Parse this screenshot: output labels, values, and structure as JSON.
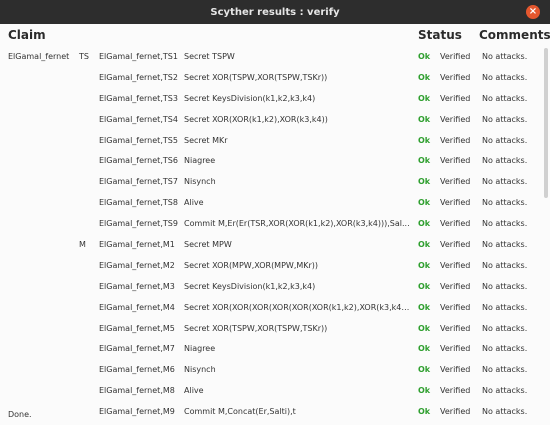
{
  "window": {
    "title": "Scyther results : verify",
    "close_glyph": "×"
  },
  "header": {
    "claim": "Claim",
    "status": "Status",
    "comments": "Comments"
  },
  "rows": [
    {
      "protocol": "ElGamal_fernet",
      "role": "TS",
      "id": "ElGamal_fernet,TS1",
      "claim": "Secret TSPW",
      "status": "Ok",
      "verified": "Verified",
      "comment": "No attacks."
    },
    {
      "protocol": "",
      "role": "",
      "id": "ElGamal_fernet,TS2",
      "claim": "Secret XOR(TSPW,XOR(TSPW,TSKr))",
      "status": "Ok",
      "verified": "Verified",
      "comment": "No attacks."
    },
    {
      "protocol": "",
      "role": "",
      "id": "ElGamal_fernet,TS3",
      "claim": "Secret KeysDivision(k1,k2,k3,k4)",
      "status": "Ok",
      "verified": "Verified",
      "comment": "No attacks."
    },
    {
      "protocol": "",
      "role": "",
      "id": "ElGamal_fernet,TS4",
      "claim": "Secret XOR(XOR(k1,k2),XOR(k3,k4))",
      "status": "Ok",
      "verified": "Verified",
      "comment": "No attacks."
    },
    {
      "protocol": "",
      "role": "",
      "id": "ElGamal_fernet,TS5",
      "claim": "Secret MKr",
      "status": "Ok",
      "verified": "Verified",
      "comment": "No attacks."
    },
    {
      "protocol": "",
      "role": "",
      "id": "ElGamal_fernet,TS6",
      "claim": "Niagree",
      "status": "Ok",
      "verified": "Verified",
      "comment": "No attacks."
    },
    {
      "protocol": "",
      "role": "",
      "id": "ElGamal_fernet,TS7",
      "claim": "Nisynch",
      "status": "Ok",
      "verified": "Verified",
      "comment": "No attacks."
    },
    {
      "protocol": "",
      "role": "",
      "id": "ElGamal_fernet,TS8",
      "claim": "Alive",
      "status": "Ok",
      "verified": "Verified",
      "comment": "No attacks."
    },
    {
      "protocol": "",
      "role": "",
      "id": "ElGamal_fernet,TS9",
      "claim": "Commit M,Er(Er(TSR,XOR(XOR(k1,k2),XOR(k3,k4))),Sal...",
      "status": "Ok",
      "verified": "Verified",
      "comment": "No attacks."
    },
    {
      "protocol": "",
      "role": "M",
      "id": "ElGamal_fernet,M1",
      "claim": "Secret MPW",
      "status": "Ok",
      "verified": "Verified",
      "comment": "No attacks."
    },
    {
      "protocol": "",
      "role": "",
      "id": "ElGamal_fernet,M2",
      "claim": "Secret XOR(MPW,XOR(MPW,MKr))",
      "status": "Ok",
      "verified": "Verified",
      "comment": "No attacks."
    },
    {
      "protocol": "",
      "role": "",
      "id": "ElGamal_fernet,M3",
      "claim": "Secret KeysDivision(k1,k2,k3,k4)",
      "status": "Ok",
      "verified": "Verified",
      "comment": "No attacks."
    },
    {
      "protocol": "",
      "role": "",
      "id": "ElGamal_fernet,M4",
      "claim": "Secret XOR(XOR(XOR(XOR(XOR(XOR(k1,k2),XOR(k3,k4)),...",
      "status": "Ok",
      "verified": "Verified",
      "comment": "No attacks."
    },
    {
      "protocol": "",
      "role": "",
      "id": "ElGamal_fernet,M5",
      "claim": "Secret XOR(TSPW,XOR(TSPW,TSKr))",
      "status": "Ok",
      "verified": "Verified",
      "comment": "No attacks."
    },
    {
      "protocol": "",
      "role": "",
      "id": "ElGamal_fernet,M7",
      "claim": "Niagree",
      "status": "Ok",
      "verified": "Verified",
      "comment": "No attacks."
    },
    {
      "protocol": "",
      "role": "",
      "id": "ElGamal_fernet,M6",
      "claim": "Nisynch",
      "status": "Ok",
      "verified": "Verified",
      "comment": "No attacks."
    },
    {
      "protocol": "",
      "role": "",
      "id": "ElGamal_fernet,M8",
      "claim": "Alive",
      "status": "Ok",
      "verified": "Verified",
      "comment": "No attacks."
    },
    {
      "protocol": "",
      "role": "",
      "id": "ElGamal_fernet,M9",
      "claim": "Commit M,Concat(Er,Salti),t",
      "status": "Ok",
      "verified": "Verified",
      "comment": "No attacks."
    }
  ],
  "status_bar": {
    "text": "Done."
  },
  "colors": {
    "ok": "#2f9f2f",
    "titlebar": "#2d2d2d",
    "close": "#e4572e"
  }
}
